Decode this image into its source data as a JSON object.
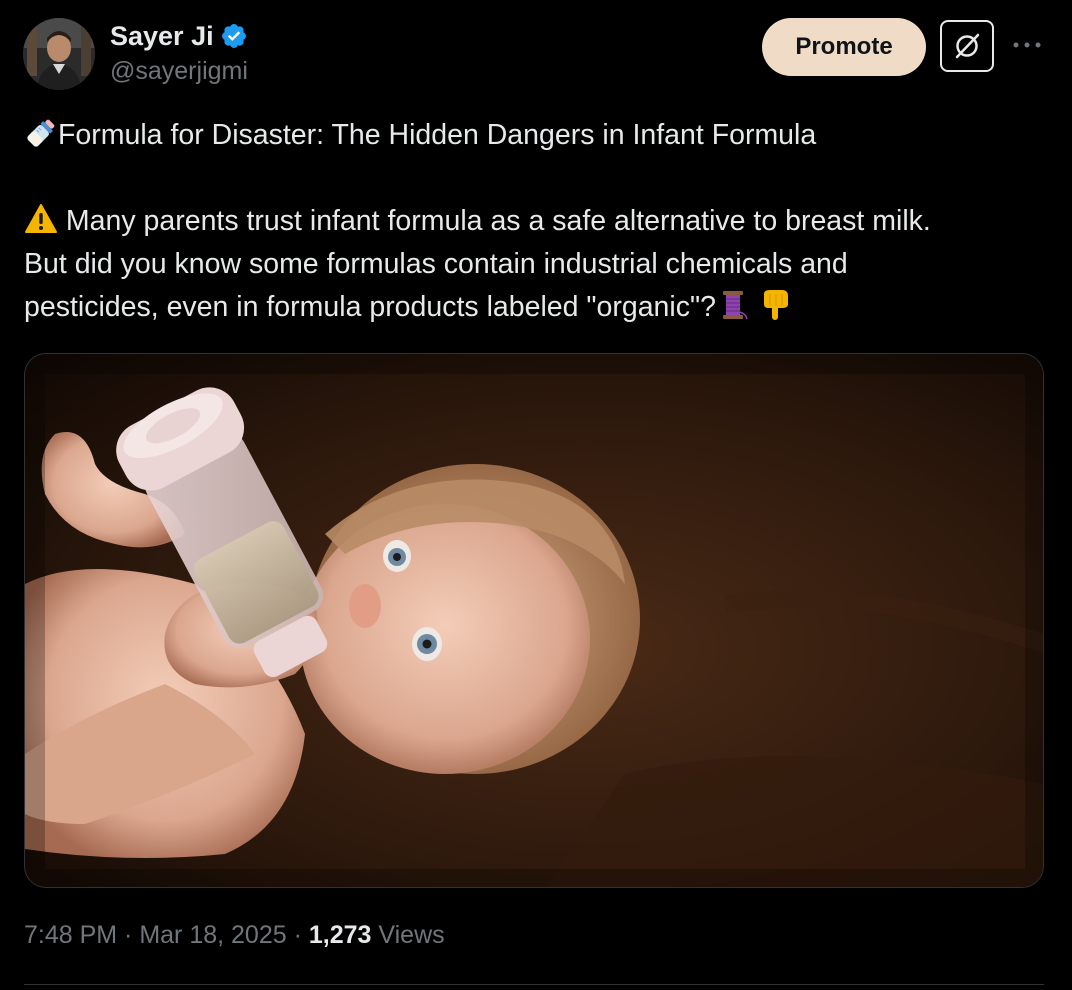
{
  "author": {
    "name": "Sayer Ji",
    "handle": "@sayerjigmi",
    "verified": true
  },
  "actions": {
    "promote_label": "Promote",
    "grok_icon": "grok-icon",
    "more_icon": "more-icon"
  },
  "tweet": {
    "headline": "Formula for Disaster: The Hidden Dangers in Infant Formula",
    "headline_emoji": "baby-bottle-icon",
    "body_line1": "Many parents trust infant formula as a safe alternative to breast milk.",
    "body_line2": "But did you know some formulas contain industrial chemicals and",
    "body_line3": "pesticides, even in formula products labeled \"organic\"?",
    "warning_emoji": "warning-icon",
    "thread_emoji": "thread-icon",
    "point_down_emoji": "point-down-icon"
  },
  "meta": {
    "time": "7:48 PM",
    "separator1": " · ",
    "date": "Mar 18, 2025",
    "separator2": " · ",
    "views_count": "1,273",
    "views_label": "Views"
  },
  "colors": {
    "background": "#000000",
    "text": "#e7e9ea",
    "secondary": "#71767b",
    "promote_bg": "#f0dcc6",
    "verified": "#1d9bf0"
  }
}
